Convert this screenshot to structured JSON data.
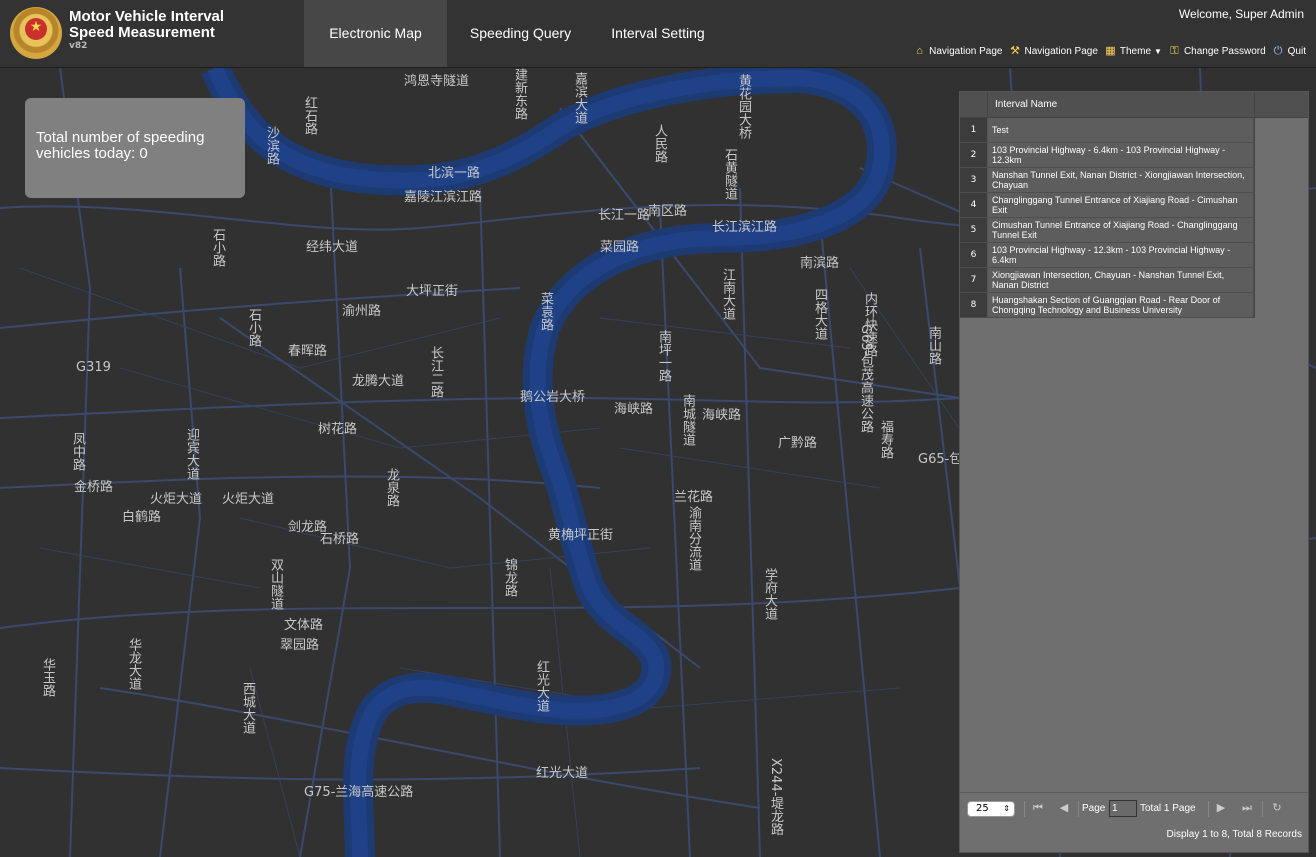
{
  "header": {
    "title_line1": "Motor Vehicle Interval",
    "title_line2": "Speed Measurement",
    "version": "v82",
    "tabs": [
      "Electronic Map",
      "Speeding Query",
      "Interval Setting"
    ],
    "active_tab": "Electronic Map",
    "welcome": "Welcome, Super Admin",
    "toolbar": {
      "nav1": "Navigation Page",
      "nav2": "Navigation Page",
      "theme": "Theme",
      "change_password": "Change Password",
      "quit": "Quit"
    }
  },
  "map": {
    "speeding_box": "Total number of speeding vehicles today: 0",
    "labels": [
      "鸿恩寺隧道",
      "建新东路",
      "嘉滨大道",
      "黄花园大桥",
      "红石路",
      "沙滨路",
      "北滨一路",
      "嘉陵江滨江路",
      "人民路",
      "石黄隧道",
      "长江一路",
      "南区路",
      "长江滨江路",
      "南滨路",
      "石小路",
      "经纬大道",
      "大坪正街",
      "渝州路",
      "石小路",
      "菜园路",
      "菜袁路",
      "江南大道",
      "四格大道",
      "内环快速路",
      "G319",
      "南坪一路",
      "龙腾大道",
      "长江二路",
      "鹅公岩大桥",
      "海峡路",
      "海峡路",
      "南城隧道",
      "广黔路",
      "凤中路",
      "迎宾大道",
      "火炬大道",
      "火炬大道",
      "金桥路",
      "剑龙路",
      "龙泉路",
      "兰花路",
      "黄桷坪正街",
      "锦龙路",
      "渝南分流道",
      "学府大道",
      "文体路",
      "翠园路",
      "双山隧道",
      "华玉路",
      "华龙大道",
      "西城大道",
      "红光大道",
      "红光大道",
      "G75-兰海高速公路",
      "X244-堤龙路",
      "福寿路",
      "G65-包茂高速公路",
      "南山路",
      "G65-包",
      "石桥路",
      "树花路",
      "白鹤路",
      "春晖路"
    ]
  },
  "grid": {
    "column_header": "Interval Name",
    "rows": [
      {
        "num": "1",
        "name": "Test"
      },
      {
        "num": "2",
        "name": "103 Provincial Highway - 6.4km - 103 Provincial Highway - 12.3km"
      },
      {
        "num": "3",
        "name": "Nanshan Tunnel Exit, Nanan District - Xiongjiawan Intersection, Chayuan"
      },
      {
        "num": "4",
        "name": "Changlinggang Tunnel Entrance of Xiajiang Road - Cimushan Exit"
      },
      {
        "num": "5",
        "name": "Cimushan Tunnel Entrance of Xiajiang Road - Changlinggang Tunnel Exit"
      },
      {
        "num": "6",
        "name": "103 Provincial Highway - 12.3km - 103 Provincial Highway - 6.4km"
      },
      {
        "num": "7",
        "name": "Xiongjiawan Intersection, Chayuan - Nanshan Tunnel Exit, Nanan District"
      },
      {
        "num": "8",
        "name": "Huangshakan Section of Guangqian Road - Rear Door of Chongqing Technology and Business University"
      }
    ],
    "pager": {
      "page_size": "25",
      "page_label": "Page",
      "page_value": "1",
      "total_pages": "Total 1 Page",
      "records": "Display 1 to 8, Total 8 Records"
    }
  },
  "colors": {
    "river": "#1f3a6e",
    "road": "#3d4f76",
    "background": "#313131"
  }
}
